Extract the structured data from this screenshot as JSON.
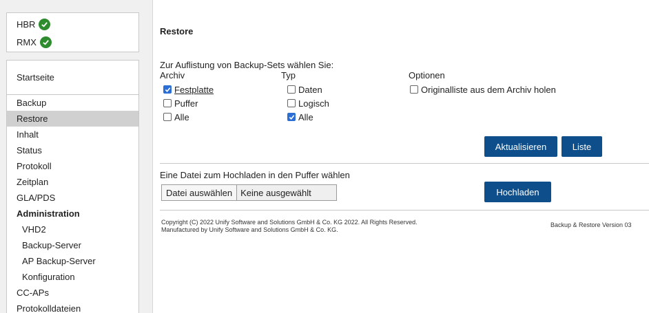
{
  "status": [
    {
      "label": "HBR",
      "state_icon": "check-circle-icon",
      "color": "#2e8b2e"
    },
    {
      "label": "RMX",
      "state_icon": "check-circle-icon",
      "color": "#2e8b2e"
    }
  ],
  "nav": {
    "home": "Startseite",
    "items": [
      {
        "label": "Backup"
      },
      {
        "label": "Restore",
        "active": true
      },
      {
        "label": "Inhalt"
      },
      {
        "label": "Status"
      },
      {
        "label": "Protokoll"
      },
      {
        "label": "Zeitplan"
      },
      {
        "label": "GLA/PDS"
      },
      {
        "label": "Administration",
        "section": true
      },
      {
        "label": "VHD2",
        "sub": true
      },
      {
        "label": "Backup-Server",
        "sub": true
      },
      {
        "label": "AP Backup-Server",
        "sub": true
      },
      {
        "label": "Konfiguration",
        "sub": true
      },
      {
        "label": "CC-APs"
      },
      {
        "label": "Protokolldateien"
      }
    ]
  },
  "main": {
    "title": "Restore",
    "intro": "Zur Auflistung von Backup-Sets wählen Sie:",
    "columns": {
      "archiv": "Archiv",
      "typ": "Typ",
      "optionen": "Optionen"
    },
    "archiv_options": [
      {
        "label": "Festplatte",
        "checked": true
      },
      {
        "label": "Puffer",
        "checked": false
      },
      {
        "label": "Alle",
        "checked": false
      }
    ],
    "typ_options": [
      {
        "label": "Daten",
        "checked": false
      },
      {
        "label": "Logisch",
        "checked": false
      },
      {
        "label": "Alle",
        "checked": true
      }
    ],
    "optionen_options": [
      {
        "label": "Originalliste aus dem Archiv holen",
        "checked": false
      }
    ],
    "buttons": {
      "refresh": "Aktualisieren",
      "list": "Liste",
      "upload": "Hochladen"
    },
    "upload": {
      "label": "Eine Datei zum Hochladen in den Puffer wählen",
      "choose": "Datei auswählen",
      "none_selected": "Keine ausgewählt"
    },
    "footer": {
      "copyright_line1": "Copyright (C) 2022 Unify Software and Solutions GmbH & Co. KG 2022. All Rights Reserved.",
      "copyright_line2": "Manufactured by Unify Software and Solutions GmbH & Co. KG.",
      "version": "Backup & Restore Version 03"
    }
  },
  "colors": {
    "button": "#0e4f8b",
    "checkbox_checked": "#2b6fd6",
    "status_ok": "#2e8b2e",
    "nav_active": "#d0d0d0"
  }
}
